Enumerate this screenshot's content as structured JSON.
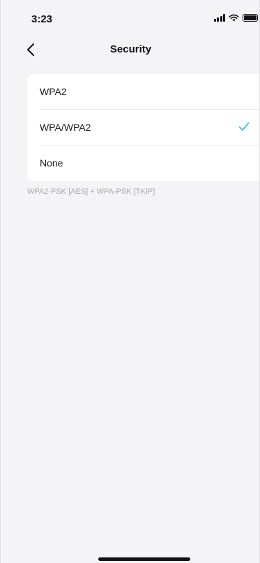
{
  "status_bar": {
    "time": "3:23",
    "icons": [
      "signal-icon",
      "wifi-icon",
      "battery-icon"
    ]
  },
  "nav": {
    "title": "Security",
    "back_icon": "chevron-left-icon"
  },
  "options": [
    {
      "label": "WPA2",
      "selected": false
    },
    {
      "label": "WPA/WPA2",
      "selected": true
    },
    {
      "label": "None",
      "selected": false
    }
  ],
  "note": "WPA2-PSK [AES] + WPA-PSK [TKIP]",
  "colors": {
    "accent": "#3ec1d3",
    "background": "#f4f4f6",
    "card": "#ffffff",
    "text": "#1b1b1b",
    "note": "#a8a8ad"
  }
}
